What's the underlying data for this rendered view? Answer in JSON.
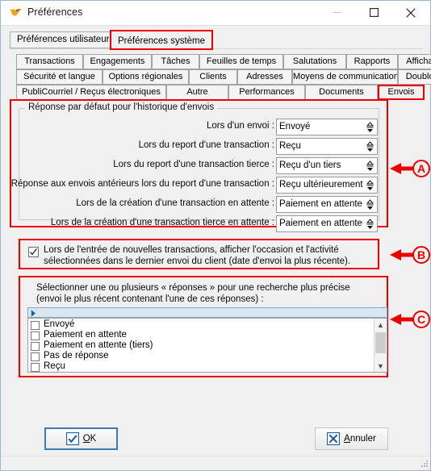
{
  "window": {
    "title": "Préférences",
    "app_icon": "bird-icon",
    "controls": {
      "minimize": "minimize-icon",
      "maximize": "maximize-icon",
      "close": "close-icon"
    }
  },
  "top_tabs": [
    {
      "label": "Préférences utilisateur",
      "active": false,
      "highlight": false
    },
    {
      "label": "Préférences système",
      "active": true,
      "highlight": true
    }
  ],
  "sub_tab_rows": [
    {
      "tabs": [
        {
          "label": "Transactions",
          "selected": false
        },
        {
          "label": "Engagements",
          "selected": false
        },
        {
          "label": "Tâches",
          "selected": false
        },
        {
          "label": "Feuilles de temps",
          "selected": false
        },
        {
          "label": "Salutations",
          "selected": false
        },
        {
          "label": "Rapports",
          "selected": false
        },
        {
          "label": "Affichage",
          "selected": false
        }
      ]
    },
    {
      "tabs": [
        {
          "label": "Sécurité et langue",
          "selected": false
        },
        {
          "label": "Options régionales",
          "selected": false
        },
        {
          "label": "Clients",
          "selected": false
        },
        {
          "label": "Adresses",
          "selected": false
        },
        {
          "label": "Moyens de communication",
          "selected": false
        },
        {
          "label": "Doublons",
          "selected": false
        }
      ]
    },
    {
      "tabs": [
        {
          "label": "PubliCourriel / Reçus électroniques",
          "selected": false
        },
        {
          "label": "Autre",
          "selected": false
        },
        {
          "label": "Performances",
          "selected": false
        },
        {
          "label": "Documents",
          "selected": false
        },
        {
          "label": "Envois",
          "selected": true
        }
      ]
    }
  ],
  "group_a": {
    "legend": "Réponse par défaut pour l'historique d'envois",
    "rows": [
      {
        "label": "Lors d'un envoi :",
        "value": "Envoyé"
      },
      {
        "label": "Lors du report d'une transaction :",
        "value": "Reçu"
      },
      {
        "label": "Lors du report d'une transaction tierce :",
        "value": "Reçu d'un tiers"
      },
      {
        "label": "Réponse aux envois antérieurs lors du report d'une transaction :",
        "value": "Reçu ultérieurement"
      },
      {
        "label": "Lors de la création d'une transaction en attente :",
        "value": "Paiement en attente"
      },
      {
        "label": "Lors de la création d'une transaction tierce en attente :",
        "value": "Paiement en attente (tiers)"
      }
    ]
  },
  "section_b": {
    "checked": true,
    "label": "Lors de l'entrée de nouvelles transactions, afficher l'occasion et l'activité sélectionnées dans le dernier envoi du client (date d'envoi la plus récente)."
  },
  "section_c": {
    "description_line1": "Sélectionner une ou plusieurs « réponses » pour une recherche plus précise",
    "description_line2": "(envoi le plus récent contenant l'une de ces réponses) :",
    "header_arrow": "right-triangle-icon",
    "items": [
      {
        "label": "Envoyé",
        "checked": false
      },
      {
        "label": "Paiement en attente",
        "checked": false
      },
      {
        "label": "Paiement en attente (tiers)",
        "checked": false
      },
      {
        "label": "Pas de réponse",
        "checked": false
      },
      {
        "label": "Reçu",
        "checked": false
      }
    ],
    "scrollbar": {
      "up": "scroll-up-icon",
      "down": "scroll-down-icon"
    }
  },
  "footer": {
    "ok": {
      "label_pre": "",
      "label_accel": "O",
      "label_post": "K",
      "icon": "check-icon"
    },
    "cancel": {
      "label_pre": "",
      "label_accel": "A",
      "label_post": "nnuler",
      "icon": "x-icon"
    }
  },
  "callouts": [
    {
      "letter": "A"
    },
    {
      "letter": "B"
    },
    {
      "letter": "C"
    }
  ],
  "colors": {
    "accent_red": "#ee0000",
    "accent_blue": "#1f5fa8",
    "window_bg": "#f0f0f0",
    "field_bg": "#ffffff"
  }
}
